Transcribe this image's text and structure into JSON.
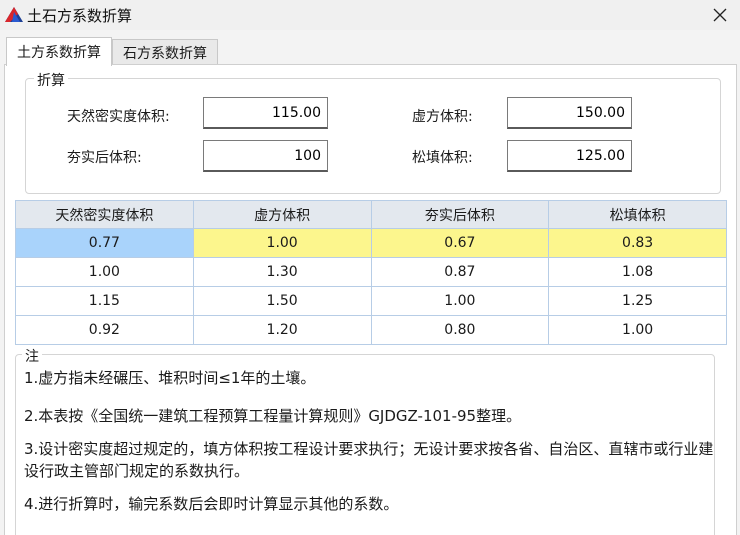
{
  "window": {
    "title": "土石方系数折算",
    "close_glyph": "✕"
  },
  "tabs": [
    {
      "label": "土方系数折算",
      "active": true
    },
    {
      "label": "石方系数折算",
      "active": false
    }
  ],
  "conversion": {
    "group_label": "折算",
    "fields": {
      "natural_volume_label": "天然密实度体积:",
      "natural_volume_value": "115.00",
      "loose_volume_label": "虚方体积:",
      "loose_volume_value": "150.00",
      "compacted_volume_label": "夯实后体积:",
      "compacted_volume_value": "100",
      "backfill_volume_label": "松填体积:",
      "backfill_volume_value": "125.00"
    }
  },
  "table": {
    "headers": [
      "天然密实度体积",
      "虚方体积",
      "夯实后体积",
      "松填体积"
    ],
    "rows": [
      [
        "0.77",
        "1.00",
        "0.67",
        "0.83"
      ],
      [
        "1.00",
        "1.30",
        "0.87",
        "1.08"
      ],
      [
        "1.15",
        "1.50",
        "1.00",
        "1.25"
      ],
      [
        "0.92",
        "1.20",
        "0.80",
        "1.00"
      ]
    ],
    "selected_color": "#a9d3fb",
    "highlight_color": "#fcf68d"
  },
  "notes": {
    "label": "注",
    "lines": [
      "1.虚方指未经碾压、堆积时间≤1年的土壤。",
      "2.本表按《全国统一建筑工程预算工程量计算规则》GJDGZ-101-95整理。",
      "3.设计密实度超过规定的，填方体积按工程设计要求执行；无设计要求按各省、自治区、直辖市或行业建设行政主管部门规定的系数执行。",
      "4.进行折算时，输完系数后会即时计算显示其他的系数。"
    ]
  }
}
